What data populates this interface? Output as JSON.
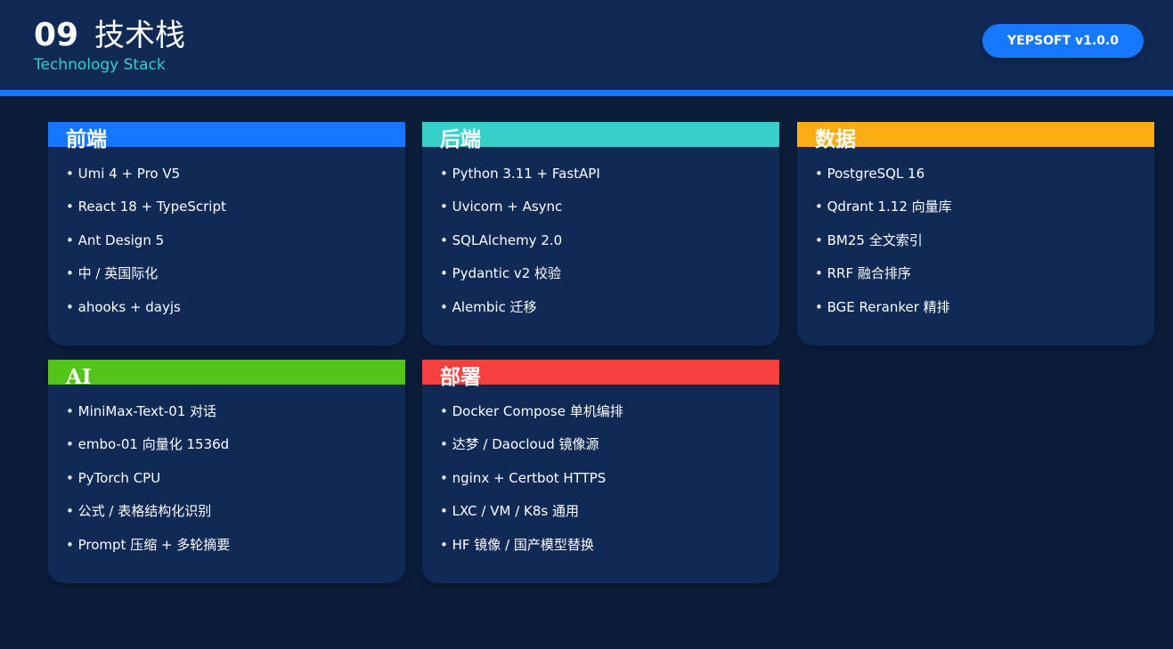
{
  "header": {
    "page_number": "09",
    "title": "技术栈",
    "subtitle": "Technology Stack",
    "version": "YEPSOFT v1.0.0"
  },
  "cards": [
    {
      "title": "前端",
      "color": "#1677ff",
      "items": [
        "Umi 4 + Pro V5",
        "React 18 + TypeScript",
        "Ant Design 5",
        "中 / 英国际化",
        "ahooks + dayjs"
      ]
    },
    {
      "title": "后端",
      "color": "#36cfc9",
      "items": [
        "Python 3.11 + FastAPI",
        "Uvicorn + Async",
        "SQLAlchemy 2.0",
        "Pydantic v2 校验",
        "Alembic 迁移"
      ]
    },
    {
      "title": "数据",
      "color": "#faad14",
      "items": [
        "PostgreSQL 16",
        "Qdrant 1.12 向量库",
        "BM25 全文索引",
        "RRF 融合排序",
        "BGE Reranker 精排"
      ]
    },
    {
      "title": "AI",
      "color": "#52c41a",
      "items": [
        "MiniMax-Text-01 对话",
        "embo-01 向量化 1536d",
        "PyTorch CPU",
        "公式 / 表格结构化识别",
        "Prompt 压缩 + 多轮摘要"
      ]
    },
    {
      "title": "部署",
      "color": "#f5403f",
      "items": [
        "Docker Compose 单机编排",
        "达梦 / Daocloud 镜像源",
        "nginx + Certbot HTTPS",
        "LXC / VM / K8s 通用",
        "HF 镜像 / 国产模型替换"
      ]
    }
  ]
}
